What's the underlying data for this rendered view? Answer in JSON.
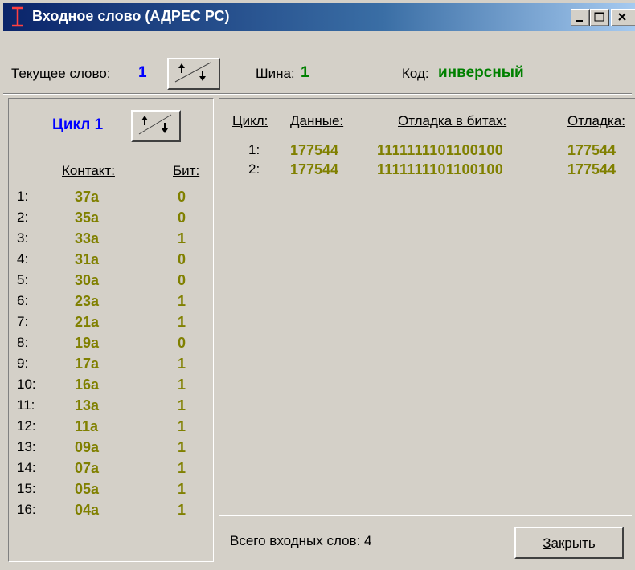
{
  "window": {
    "title": "Входное слово (АДРЕС РС)"
  },
  "top": {
    "current_word_label": "Текущее слово:",
    "current_word_value": "1",
    "bus_label": "Шина:",
    "bus_value": "1",
    "code_label": "Код:",
    "code_value": "инверсный"
  },
  "left": {
    "cycle_title": "Цикл 1",
    "contact_header": "Контакт:",
    "bit_header": "Бит:",
    "rows": [
      {
        "idx": "1:",
        "contact": "37a",
        "bit": "0"
      },
      {
        "idx": "2:",
        "contact": "35a",
        "bit": "0"
      },
      {
        "idx": "3:",
        "contact": "33a",
        "bit": "1"
      },
      {
        "idx": "4:",
        "contact": "31a",
        "bit": "0"
      },
      {
        "idx": "5:",
        "contact": "30a",
        "bit": "0"
      },
      {
        "idx": "6:",
        "contact": "23a",
        "bit": "1"
      },
      {
        "idx": "7:",
        "contact": "21a",
        "bit": "1"
      },
      {
        "idx": "8:",
        "contact": "19a",
        "bit": "0"
      },
      {
        "idx": "9:",
        "contact": "17a",
        "bit": "1"
      },
      {
        "idx": "10:",
        "contact": "16a",
        "bit": "1"
      },
      {
        "idx": "11:",
        "contact": "13a",
        "bit": "1"
      },
      {
        "idx": "12:",
        "contact": "11a",
        "bit": "1"
      },
      {
        "idx": "13:",
        "contact": "09a",
        "bit": "1"
      },
      {
        "idx": "14:",
        "contact": "07a",
        "bit": "1"
      },
      {
        "idx": "15:",
        "contact": "05a",
        "bit": "1"
      },
      {
        "idx": "16:",
        "contact": "04a",
        "bit": "1"
      }
    ]
  },
  "right": {
    "headers": {
      "cycle": "Цикл:",
      "data": "Данные:",
      "bits": "Отладка в битах:",
      "debug": "Отладка:"
    },
    "rows": [
      {
        "cycle": "1:",
        "data": "177544",
        "bits": "1111111101100100",
        "debug": "177544"
      },
      {
        "cycle": "2:",
        "data": "177544",
        "bits": "1111111101100100",
        "debug": "177544"
      }
    ]
  },
  "footer": {
    "status": "Всего входных слов: 4",
    "close_label": "Закрыть"
  }
}
